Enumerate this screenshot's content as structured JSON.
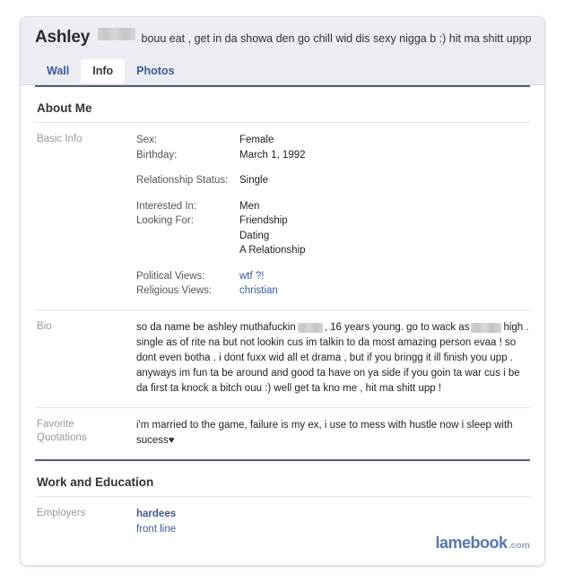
{
  "profile": {
    "name": "Ashley",
    "name_redacted": "[redacted]",
    "status": "bouu eat , get in da showa den go chill wid dis sexy nigga b :) hit ma shitt uppp !",
    "tabs": [
      {
        "label": "Wall",
        "active": false
      },
      {
        "label": "Info",
        "active": true
      },
      {
        "label": "Photos",
        "active": false
      }
    ]
  },
  "sections": {
    "about": {
      "title": "About Me",
      "basic_info": {
        "label": "Basic Info",
        "fields": [
          {
            "label": "Sex:",
            "value": "Female"
          },
          {
            "label": "Birthday:",
            "value": "March 1, 1992"
          },
          {
            "label": "Relationship Status:",
            "value": "Single"
          },
          {
            "label": "Interested In:",
            "value": "Men"
          },
          {
            "label": "Looking For:",
            "value": "Friendship"
          },
          {
            "label": "",
            "value": "Dating"
          },
          {
            "label": "",
            "value": "A Relationship"
          },
          {
            "label": "Political Views:",
            "value": "wtf ?!",
            "link": true
          },
          {
            "label": "Religious Views:",
            "value": "christian",
            "link": true
          }
        ]
      },
      "bio": {
        "label": "Bio",
        "part1": "so da name be ashley muthafuckin",
        "part2": ", 16 years young. go to wack as",
        "part3": "high . single as of rite na but not lookin cus im talkin to da most amazing person evaa ! so dont even botha . i dont fuxx wid all et drama , but if you bringg it ill finish you upp . anyways im fun ta be around and good ta have on ya side if you goin ta war cus i be da first ta knock a bitch ouu :) well get ta kno me , hit ma shitt upp !"
      },
      "quotations": {
        "label_line1": "Favorite",
        "label_line2": "Quotations",
        "text": "i'm married to the game, failure is my ex, i use to mess with hustle now i sleep with sucess",
        "heart": "♥"
      }
    },
    "work": {
      "title": "Work and Education",
      "employers": {
        "label": "Employers",
        "primary": "hardees",
        "secondary": "front line"
      }
    }
  },
  "watermark": {
    "main": "lamebook",
    "tld": ".com"
  },
  "colors": {
    "link": "#3b5998",
    "header_band": "#eceef4",
    "label_gray": "#999999"
  }
}
